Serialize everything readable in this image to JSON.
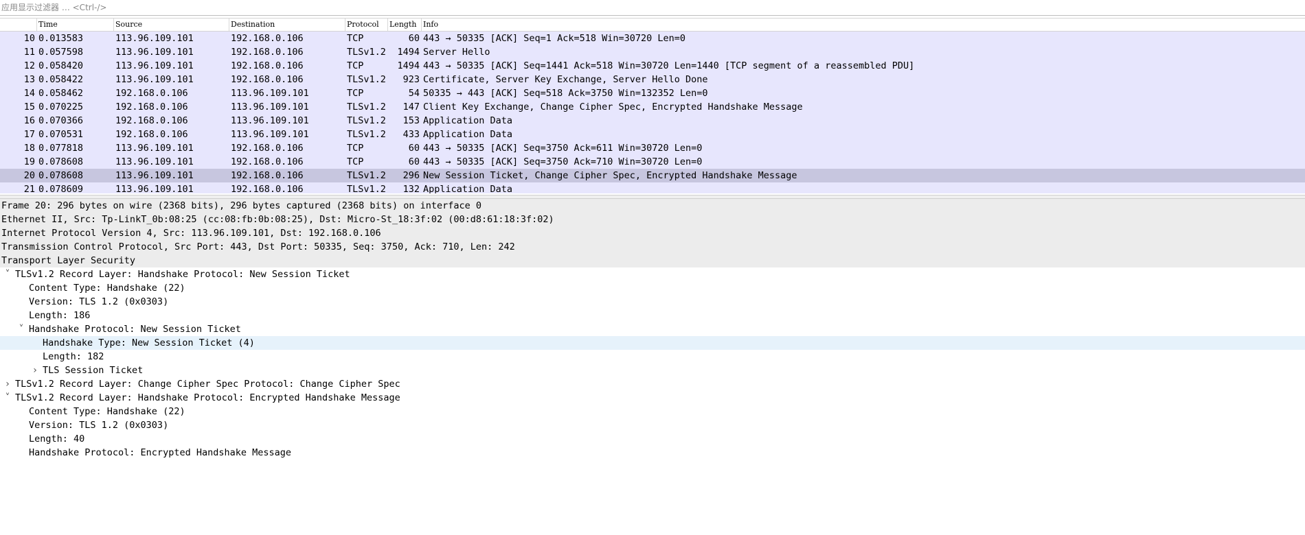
{
  "filter": {
    "placeholder": "应用显示过滤器 … <Ctrl-/>"
  },
  "columns": [
    "Time",
    "Source",
    "Destination",
    "Protocol",
    "Length",
    "Info"
  ],
  "packets": [
    {
      "no": "10",
      "time": "0.013583",
      "src": "113.96.109.101",
      "dst": "192.168.0.106",
      "proto": "TCP",
      "len": "60",
      "info": "443 → 50335 [ACK] Seq=1 Ack=518 Win=30720 Len=0"
    },
    {
      "no": "11",
      "time": "0.057598",
      "src": "113.96.109.101",
      "dst": "192.168.0.106",
      "proto": "TLSv1.2",
      "len": "1494",
      "info": "Server Hello"
    },
    {
      "no": "12",
      "time": "0.058420",
      "src": "113.96.109.101",
      "dst": "192.168.0.106",
      "proto": "TCP",
      "len": "1494",
      "info": "443 → 50335 [ACK] Seq=1441 Ack=518 Win=30720 Len=1440 [TCP segment of a reassembled PDU]"
    },
    {
      "no": "13",
      "time": "0.058422",
      "src": "113.96.109.101",
      "dst": "192.168.0.106",
      "proto": "TLSv1.2",
      "len": "923",
      "info": "Certificate, Server Key Exchange, Server Hello Done"
    },
    {
      "no": "14",
      "time": "0.058462",
      "src": "192.168.0.106",
      "dst": "113.96.109.101",
      "proto": "TCP",
      "len": "54",
      "info": "50335 → 443 [ACK] Seq=518 Ack=3750 Win=132352 Len=0"
    },
    {
      "no": "15",
      "time": "0.070225",
      "src": "192.168.0.106",
      "dst": "113.96.109.101",
      "proto": "TLSv1.2",
      "len": "147",
      "info": "Client Key Exchange, Change Cipher Spec, Encrypted Handshake Message"
    },
    {
      "no": "16",
      "time": "0.070366",
      "src": "192.168.0.106",
      "dst": "113.96.109.101",
      "proto": "TLSv1.2",
      "len": "153",
      "info": "Application Data"
    },
    {
      "no": "17",
      "time": "0.070531",
      "src": "192.168.0.106",
      "dst": "113.96.109.101",
      "proto": "TLSv1.2",
      "len": "433",
      "info": "Application Data"
    },
    {
      "no": "18",
      "time": "0.077818",
      "src": "113.96.109.101",
      "dst": "192.168.0.106",
      "proto": "TCP",
      "len": "60",
      "info": "443 → 50335 [ACK] Seq=3750 Ack=611 Win=30720 Len=0"
    },
    {
      "no": "19",
      "time": "0.078608",
      "src": "113.96.109.101",
      "dst": "192.168.0.106",
      "proto": "TCP",
      "len": "60",
      "info": "443 → 50335 [ACK] Seq=3750 Ack=710 Win=30720 Len=0"
    },
    {
      "no": "20",
      "time": "0.078608",
      "src": "113.96.109.101",
      "dst": "192.168.0.106",
      "proto": "TLSv1.2",
      "len": "296",
      "info": "New Session Ticket, Change Cipher Spec, Encrypted Handshake Message",
      "selected": true
    },
    {
      "no": "21",
      "time": "0.078609",
      "src": "113.96.109.101",
      "dst": "192.168.0.106",
      "proto": "TLSv1.2",
      "len": "132",
      "info": "Application Data"
    }
  ],
  "details": [
    {
      "text": "Frame 20: 296 bytes on wire (2368 bits), 296 bytes captured (2368 bits) on interface 0",
      "level": 0,
      "gray": true
    },
    {
      "text": "Ethernet II, Src: Tp-LinkT_0b:08:25 (cc:08:fb:0b:08:25), Dst: Micro-St_18:3f:02 (00:d8:61:18:3f:02)",
      "level": 0,
      "gray": true
    },
    {
      "text": "Internet Protocol Version 4, Src: 113.96.109.101, Dst: 192.168.0.106",
      "level": 0,
      "gray": true
    },
    {
      "text": "Transmission Control Protocol, Src Port: 443, Dst Port: 50335, Seq: 3750, Ack: 710, Len: 242",
      "level": 0,
      "gray": true
    },
    {
      "text": "Transport Layer Security",
      "level": 0,
      "gray": true
    },
    {
      "text": "TLSv1.2 Record Layer: Handshake Protocol: New Session Ticket",
      "level": 1,
      "arrow": "expanded"
    },
    {
      "text": "Content Type: Handshake (22)",
      "level": 2
    },
    {
      "text": "Version: TLS 1.2 (0x0303)",
      "level": 2
    },
    {
      "text": "Length: 186",
      "level": 2
    },
    {
      "text": "Handshake Protocol: New Session Ticket",
      "level": 2,
      "arrow": "expanded"
    },
    {
      "text": "Handshake Type: New Session Ticket (4)",
      "level": 3,
      "highlight": true
    },
    {
      "text": "Length: 182",
      "level": 3
    },
    {
      "text": "TLS Session Ticket",
      "level": 3,
      "arrow": "collapsed"
    },
    {
      "text": "TLSv1.2 Record Layer: Change Cipher Spec Protocol: Change Cipher Spec",
      "level": 1,
      "arrow": "collapsed"
    },
    {
      "text": "TLSv1.2 Record Layer: Handshake Protocol: Encrypted Handshake Message",
      "level": 1,
      "arrow": "expanded"
    },
    {
      "text": "Content Type: Handshake (22)",
      "level": 2
    },
    {
      "text": "Version: TLS 1.2 (0x0303)",
      "level": 2
    },
    {
      "text": "Length: 40",
      "level": 2
    },
    {
      "text": "Handshake Protocol: Encrypted Handshake Message",
      "level": 2
    }
  ],
  "icons": {
    "expanded": "chevron-down-icon",
    "collapsed": "chevron-right-icon"
  }
}
